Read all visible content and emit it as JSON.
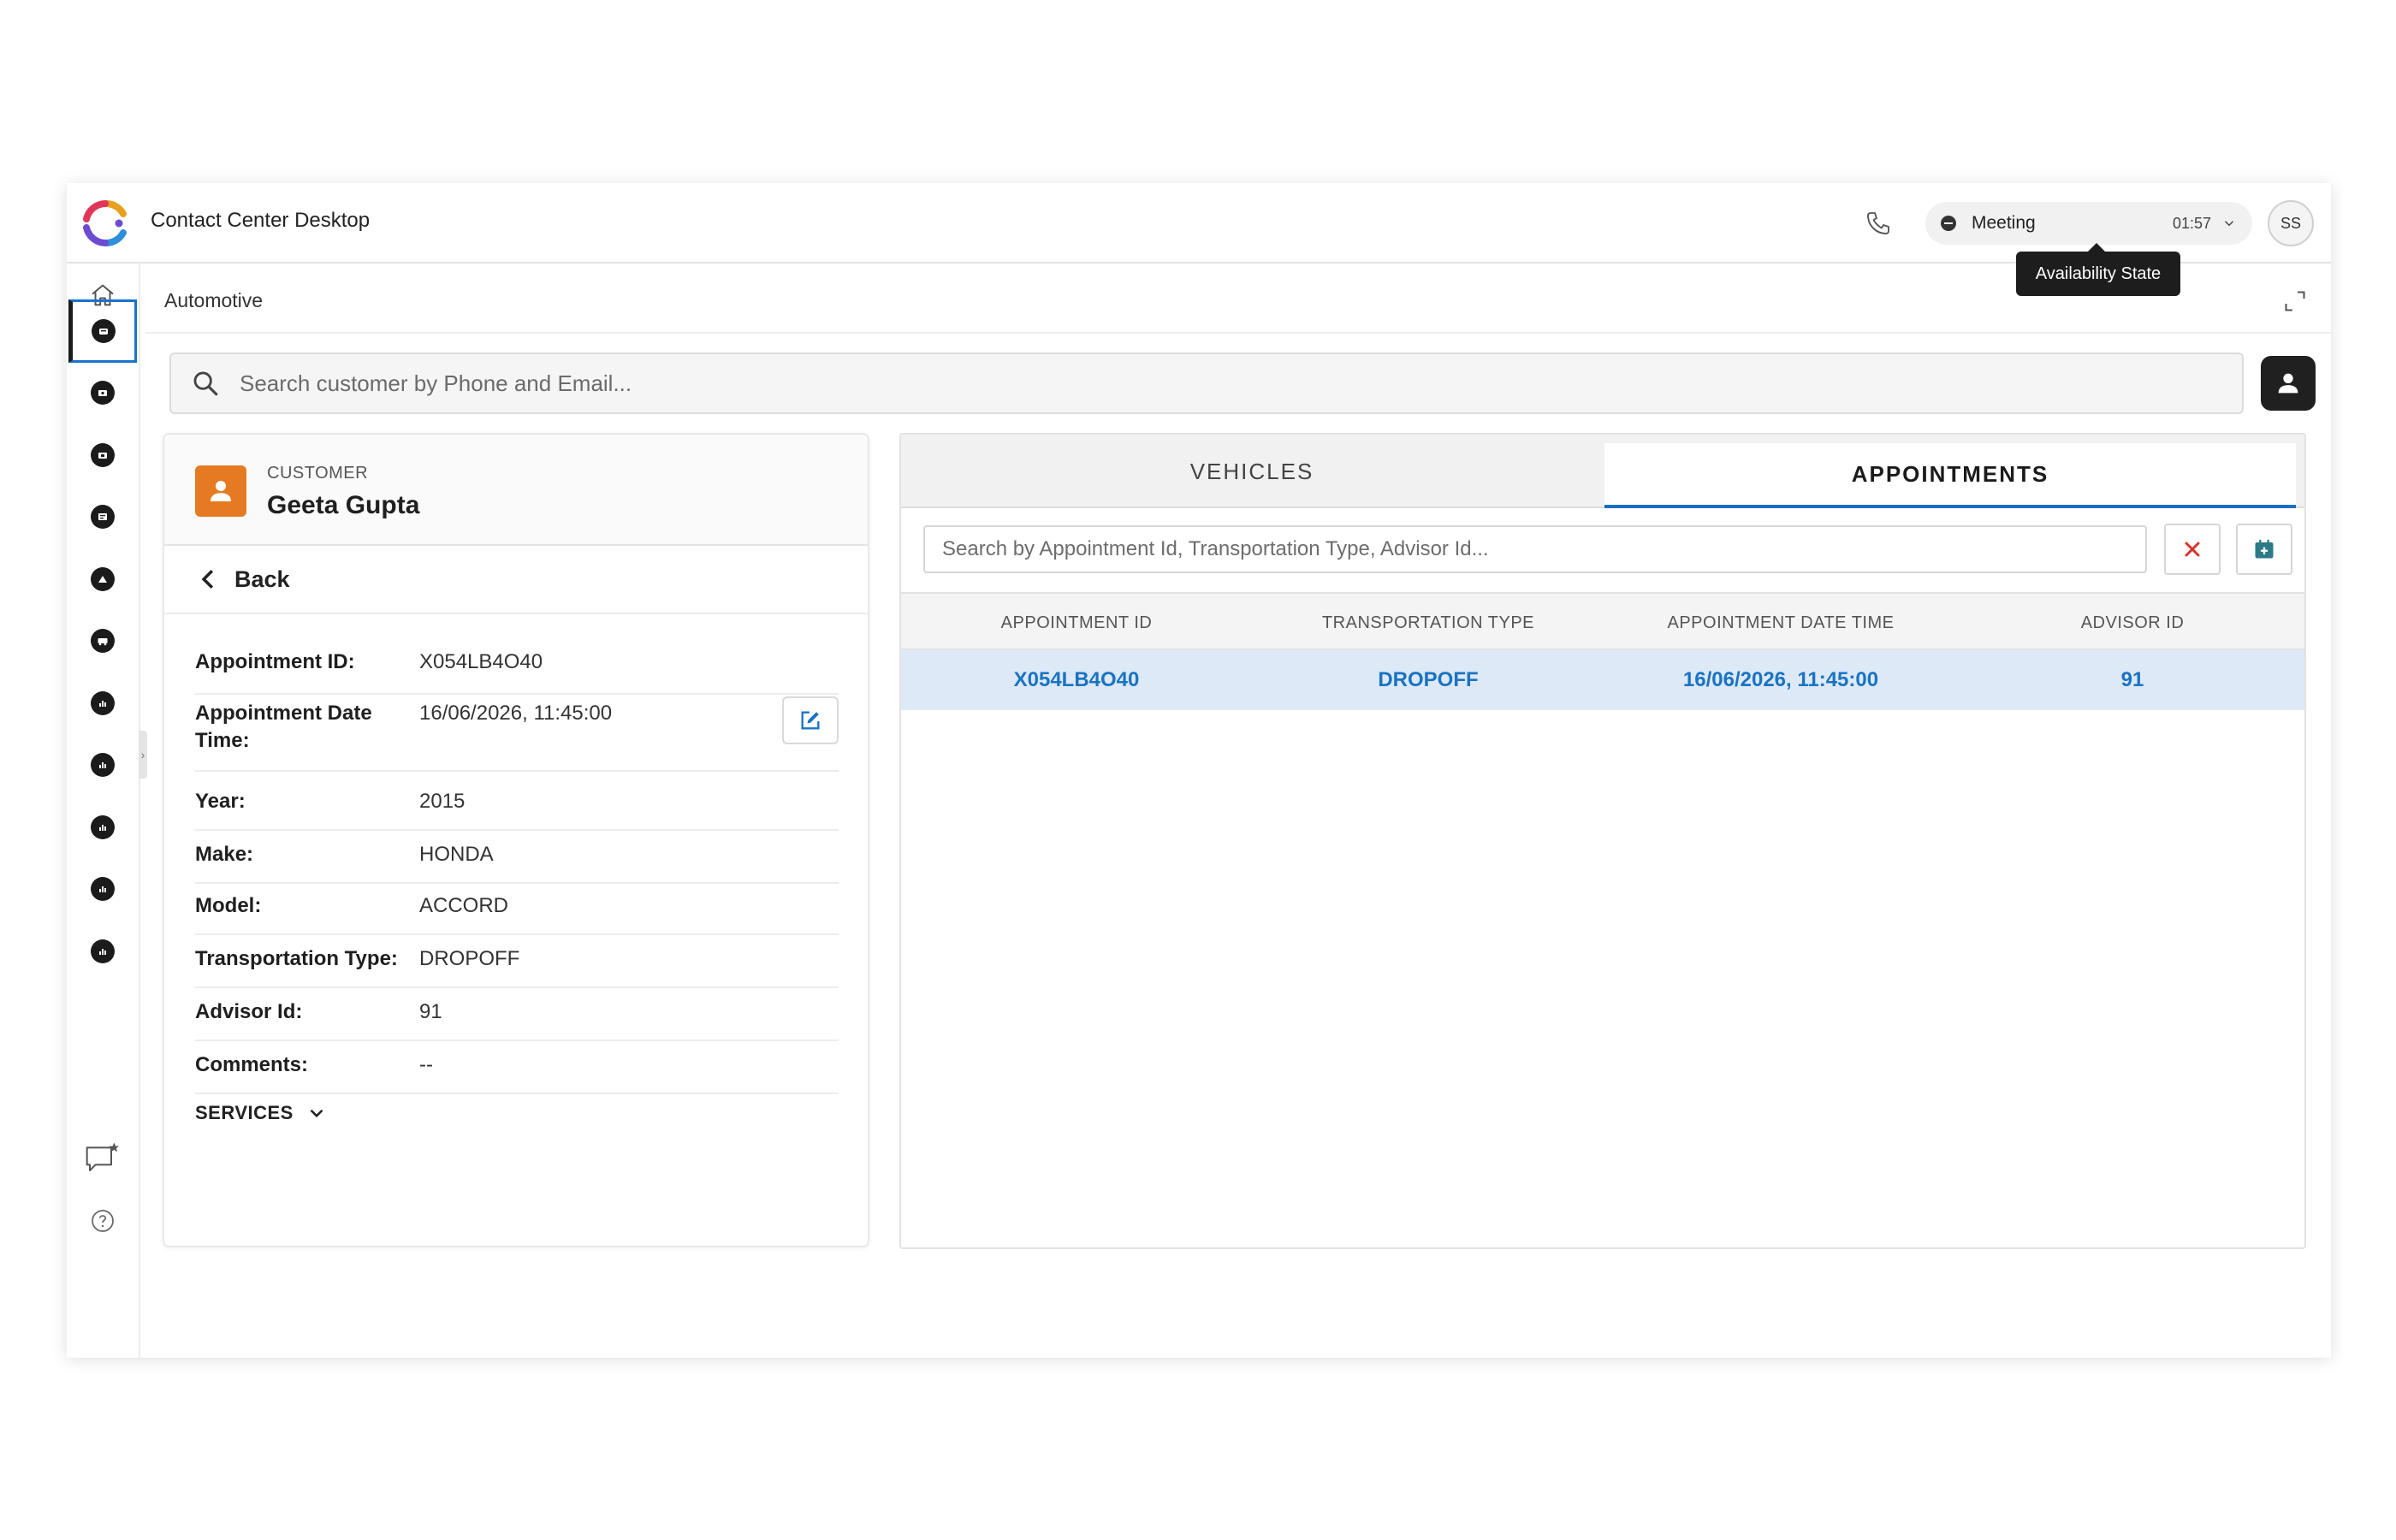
{
  "app": {
    "title": "Contact Center Desktop"
  },
  "header": {
    "status": {
      "label": "Meeting",
      "timer": "01:57"
    },
    "tooltip": "Availability State",
    "user_initials": "SS"
  },
  "breadcrumb": "Automotive",
  "search": {
    "placeholder": "Search customer by Phone and Email..."
  },
  "customer": {
    "label": "CUSTOMER",
    "name": "Geeta Gupta",
    "back_label": "Back",
    "details": [
      {
        "key": "Appointment ID:",
        "value": "X054LB4O40"
      },
      {
        "key": "Appointment Date Time:",
        "value": "16/06/2026, 11:45:00"
      },
      {
        "key": "Year:",
        "value": "2015"
      },
      {
        "key": "Make:",
        "value": "HONDA"
      },
      {
        "key": "Model:",
        "value": "ACCORD"
      },
      {
        "key": "Transportation Type:",
        "value": "DROPOFF"
      },
      {
        "key": "Advisor Id:",
        "value": "91"
      },
      {
        "key": "Comments:",
        "value": "--"
      }
    ],
    "services_label": "SERVICES"
  },
  "appointments_panel": {
    "tabs": [
      {
        "label": "VEHICLES",
        "active": false
      },
      {
        "label": "APPOINTMENTS",
        "active": true
      }
    ],
    "filter_placeholder": "Search by Appointment Id, Transportation Type, Advisor Id...",
    "columns": [
      "APPOINTMENT ID",
      "TRANSPORTATION TYPE",
      "APPOINTMENT DATE TIME",
      "ADVISOR ID"
    ],
    "rows": [
      [
        "X054LB4O40",
        "DROPOFF",
        "16/06/2026, 11:45:00",
        "91"
      ]
    ]
  },
  "colors": {
    "accent": "#1a73c2",
    "customer_avatar": "#e57a22",
    "selected_row": "#dde9f7",
    "clear_icon": "#d9342b",
    "calendar_icon": "#2c7a86"
  },
  "icons": [
    "logo-icon",
    "phone-icon",
    "bell-icon",
    "chevron-down-icon",
    "home-icon",
    "expand-icon",
    "search-icon",
    "user-icon",
    "chevron-left-icon",
    "edit-icon",
    "close-icon",
    "calendar-icon",
    "chat-star-icon",
    "help-icon"
  ]
}
